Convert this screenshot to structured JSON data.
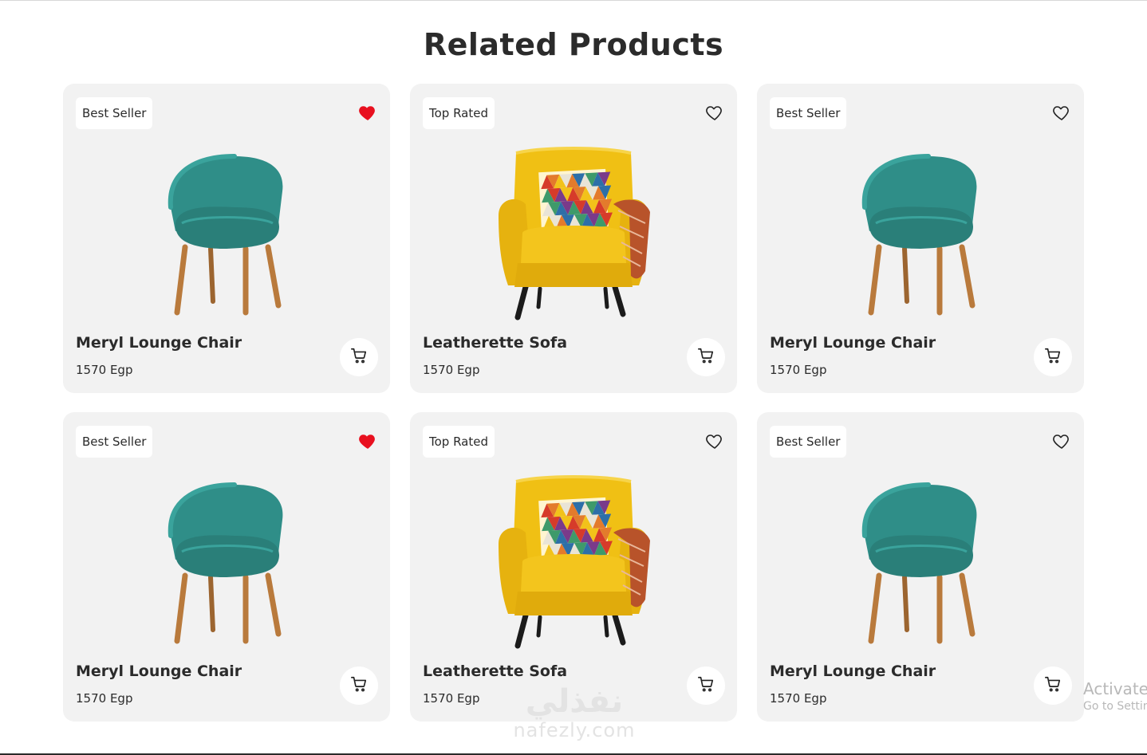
{
  "section": {
    "title": "Related Products"
  },
  "colors": {
    "card_bg": "#f2f2f2",
    "heart_active": "#e8101f",
    "chair_teal": "#2f8e88",
    "chair_wood": "#b97a3c",
    "sofa_yellow": "#f0c014"
  },
  "products": [
    {
      "badge": "Best Seller",
      "name": "Meryl Lounge Chair",
      "price": "1570 Egp",
      "favorited": true,
      "image_icon": "teal-lounge-chair",
      "cart_icon": "cart-icon"
    },
    {
      "badge": "Top Rated",
      "name": "Leatherette Sofa",
      "price": "1570 Egp",
      "favorited": false,
      "image_icon": "yellow-armchair",
      "cart_icon": "cart-icon"
    },
    {
      "badge": "Best Seller",
      "name": "Meryl Lounge Chair",
      "price": "1570 Egp",
      "favorited": false,
      "image_icon": "teal-lounge-chair",
      "cart_icon": "cart-icon"
    },
    {
      "badge": "Best Seller",
      "name": "Meryl Lounge Chair",
      "price": "1570 Egp",
      "favorited": true,
      "image_icon": "teal-lounge-chair",
      "cart_icon": "cart-icon"
    },
    {
      "badge": "Top Rated",
      "name": "Leatherette Sofa",
      "price": "1570 Egp",
      "favorited": false,
      "image_icon": "yellow-armchair",
      "cart_icon": "cart-icon"
    },
    {
      "badge": "Best Seller",
      "name": "Meryl Lounge Chair",
      "price": "1570 Egp",
      "favorited": false,
      "image_icon": "teal-lounge-chair",
      "cart_icon": "cart-icon"
    }
  ],
  "watermark": {
    "arabic": "نفذلي",
    "latin": "nafezly.com"
  },
  "os_notice": {
    "line1": "Activate Windows",
    "line2": "Go to Settings to activate Windows."
  }
}
